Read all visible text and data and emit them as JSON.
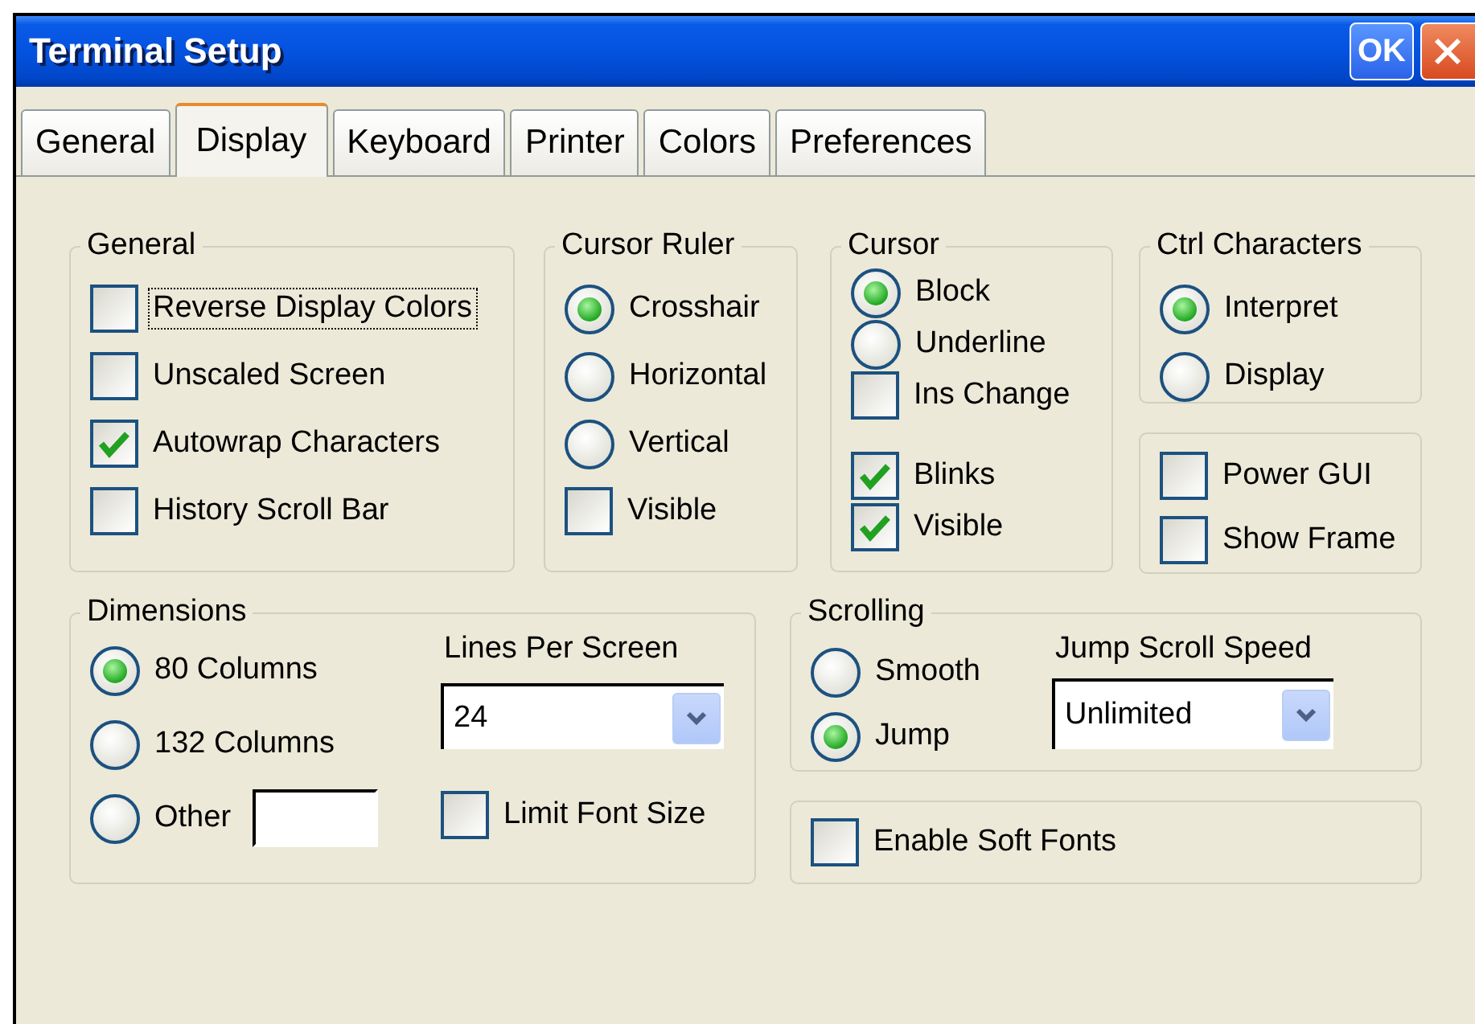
{
  "window": {
    "title": "Terminal Setup",
    "ok_button": "OK"
  },
  "tabs": [
    {
      "label": "General",
      "selected": false
    },
    {
      "label": "Display",
      "selected": true
    },
    {
      "label": "Keyboard",
      "selected": false
    },
    {
      "label": "Printer",
      "selected": false
    },
    {
      "label": "Colors",
      "selected": false
    },
    {
      "label": "Preferences",
      "selected": false
    }
  ],
  "general": {
    "title": "General",
    "controls": [
      {
        "kind": "checkbox",
        "label": "Reverse Display Colors",
        "checked": false,
        "focused": true
      },
      {
        "kind": "checkbox",
        "label": "Unscaled Screen",
        "checked": false,
        "focused": false
      },
      {
        "kind": "checkbox",
        "label": "Autowrap Characters",
        "checked": true,
        "focused": false
      },
      {
        "kind": "checkbox",
        "label": "History Scroll Bar",
        "checked": false,
        "focused": false
      }
    ]
  },
  "cursor_ruler": {
    "title": "Cursor Ruler",
    "controls": [
      {
        "kind": "radio",
        "label": "Crosshair",
        "selected": true
      },
      {
        "kind": "radio",
        "label": "Horizontal",
        "selected": false
      },
      {
        "kind": "radio",
        "label": "Vertical",
        "selected": false
      },
      {
        "kind": "checkbox",
        "label": "Visible",
        "checked": false,
        "focused": false
      }
    ]
  },
  "cursor": {
    "title": "Cursor",
    "controls": [
      {
        "kind": "radio",
        "label": "Block",
        "selected": true
      },
      {
        "kind": "radio",
        "label": "Underline",
        "selected": false
      },
      {
        "kind": "checkbox",
        "label": "Ins Change",
        "checked": false,
        "focused": false
      },
      {
        "kind": "checkbox",
        "label": "Blinks",
        "checked": true,
        "focused": false
      },
      {
        "kind": "checkbox",
        "label": "Visible",
        "checked": true,
        "focused": false
      }
    ]
  },
  "ctrl_characters": {
    "title": "Ctrl Characters",
    "controls": [
      {
        "kind": "radio",
        "label": "Interpret",
        "selected": true
      },
      {
        "kind": "radio",
        "label": "Display",
        "selected": false
      }
    ]
  },
  "gui_options": {
    "controls": [
      {
        "kind": "checkbox",
        "label": "Power GUI",
        "checked": false,
        "focused": false
      },
      {
        "kind": "checkbox",
        "label": "Show Frame",
        "checked": false,
        "focused": false
      }
    ]
  },
  "dimensions": {
    "title": "Dimensions",
    "controls": [
      {
        "kind": "radio",
        "label": "80 Columns",
        "selected": true
      },
      {
        "kind": "radio",
        "label": "132 Columns",
        "selected": false
      },
      {
        "kind": "radio_field",
        "label": "Other",
        "selected": false
      }
    ],
    "lines_label": "Lines Per Screen",
    "lines_value": "24",
    "options": [
      {
        "kind": "checkbox",
        "label": "Limit Font Size",
        "checked": false,
        "focused": false
      }
    ]
  },
  "scrolling": {
    "title": "Scrolling",
    "controls": [
      {
        "kind": "radio",
        "label": "Smooth",
        "selected": false
      },
      {
        "kind": "radio",
        "label": "Jump",
        "selected": true
      }
    ],
    "speed_label": "Jump Scroll Speed",
    "speed_value": "Unlimited"
  },
  "fonts": {
    "controls": [
      {
        "kind": "checkbox",
        "label": "Enable Soft Fonts",
        "checked": false,
        "focused": false
      }
    ]
  }
}
